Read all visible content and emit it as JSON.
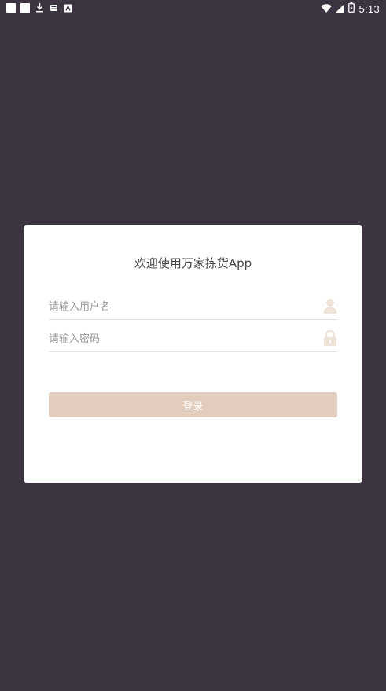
{
  "status_bar": {
    "time": "5:13",
    "icons": [
      "notification-square-icon",
      "notification-square-icon",
      "download-icon",
      "message-icon",
      "keyboard-icon",
      "wifi-icon",
      "signal-icon",
      "battery-icon"
    ]
  },
  "login": {
    "title": "欢迎使用万家拣货App",
    "username_placeholder": "请输入用户名",
    "password_placeholder": "请输入密码",
    "login_label": "登录"
  },
  "colors": {
    "background": "#3d3442",
    "card": "#ffffff",
    "button": "#e2ccbd",
    "icon": "#f0e3d8"
  }
}
